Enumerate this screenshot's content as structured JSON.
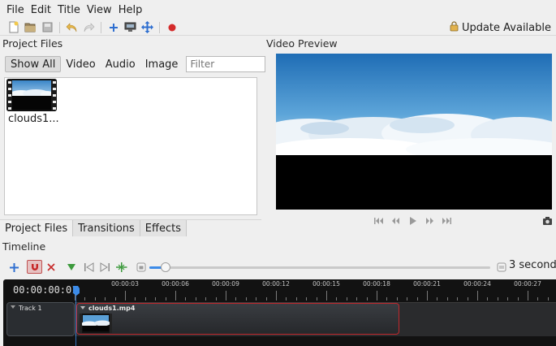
{
  "menubar": {
    "items": [
      "File",
      "Edit",
      "Title",
      "View",
      "Help"
    ]
  },
  "toolbar": {
    "buttons": [
      "new-project-icon",
      "open-project-icon",
      "save-project-icon",
      "undo-icon",
      "redo-icon",
      "import-files-icon",
      "profile-icon",
      "fullscreen-icon",
      "export-video-icon"
    ],
    "update_label": "Update Available"
  },
  "project_files": {
    "heading": "Project Files",
    "filters": [
      "Show All",
      "Video",
      "Audio",
      "Image"
    ],
    "active_filter": "Show All",
    "filter_placeholder": "Filter",
    "files": [
      {
        "name": "clouds1..."
      }
    ]
  },
  "bottom_tabs": [
    "Project Files",
    "Transitions",
    "Effects"
  ],
  "preview": {
    "heading": "Video Preview"
  },
  "timeline": {
    "heading": "Timeline",
    "zoom_value": 3,
    "zoom_label": "3 seconds",
    "timecode": "00:00:00:01",
    "ruler_labels": [
      "00:00:03",
      "00:00:06",
      "00:00:09",
      "00:00:12",
      "00:00:15",
      "00:00:18",
      "00:00:21",
      "00:00:24",
      "00:00:27"
    ],
    "track_name": "Track 1",
    "clip_name": "clouds1.mp4"
  },
  "colors": {
    "accent": "#3c8be8",
    "clip_border": "#c0282d",
    "timeline_bg": "#121212"
  }
}
